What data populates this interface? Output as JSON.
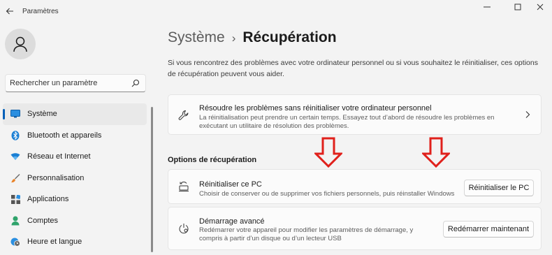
{
  "window": {
    "title": "Paramètres",
    "back_icon": "back-arrow-icon",
    "controls": {
      "minimize": "—",
      "maximize": "☐",
      "close": "✕"
    }
  },
  "sidebar": {
    "avatar_icon": "user-icon",
    "search": {
      "placeholder": "Rechercher un paramètre",
      "icon": "search-icon"
    },
    "items": [
      {
        "label": "Système",
        "icon": "display-icon",
        "active": true
      },
      {
        "label": "Bluetooth et appareils",
        "icon": "bluetooth-icon",
        "active": false
      },
      {
        "label": "Réseau et Internet",
        "icon": "wifi-icon",
        "active": false
      },
      {
        "label": "Personnalisation",
        "icon": "brush-icon",
        "active": false
      },
      {
        "label": "Applications",
        "icon": "apps-icon",
        "active": false
      },
      {
        "label": "Comptes",
        "icon": "person-icon",
        "active": false
      },
      {
        "label": "Heure et langue",
        "icon": "globe-clock-icon",
        "active": false
      }
    ]
  },
  "main": {
    "breadcrumb": {
      "parent": "Système",
      "separator": "›",
      "current": "Récupération"
    },
    "intro": "Si vous rencontrez des problèmes avec votre ordinateur personnel ou si vous souhaitez le réinitialiser, ces options de récupération peuvent vous aider.",
    "troubleshoot_card": {
      "title": "Résoudre les problèmes sans réinitialiser votre ordinateur personnel",
      "description": "La réinitialisation peut prendre un certain temps. Essayez tout d’abord de résoudre les problèmes en exécutant un utilitaire de résolution des problèmes.",
      "icon": "wrench-icon"
    },
    "section_title": "Options de récupération",
    "reset_card": {
      "title": "Réinitialiser ce PC",
      "description": "Choisir de conserver ou de supprimer vos fichiers personnels, puis réinstaller Windows",
      "button": "Réinitialiser le PC",
      "icon": "reset-pc-icon"
    },
    "advanced_card": {
      "title": "Démarrage avancé",
      "description": "Redémarrer votre appareil pour modifier les paramètres de démarrage, y compris à partir d’un disque ou d’un lecteur USB",
      "button": "Redémarrer maintenant",
      "icon": "advanced-startup-icon"
    }
  },
  "colors": {
    "accent": "#005fb8",
    "annotation_arrow": "#e0201b",
    "background": "#f3f3f3",
    "card": "#fbfbfb"
  }
}
